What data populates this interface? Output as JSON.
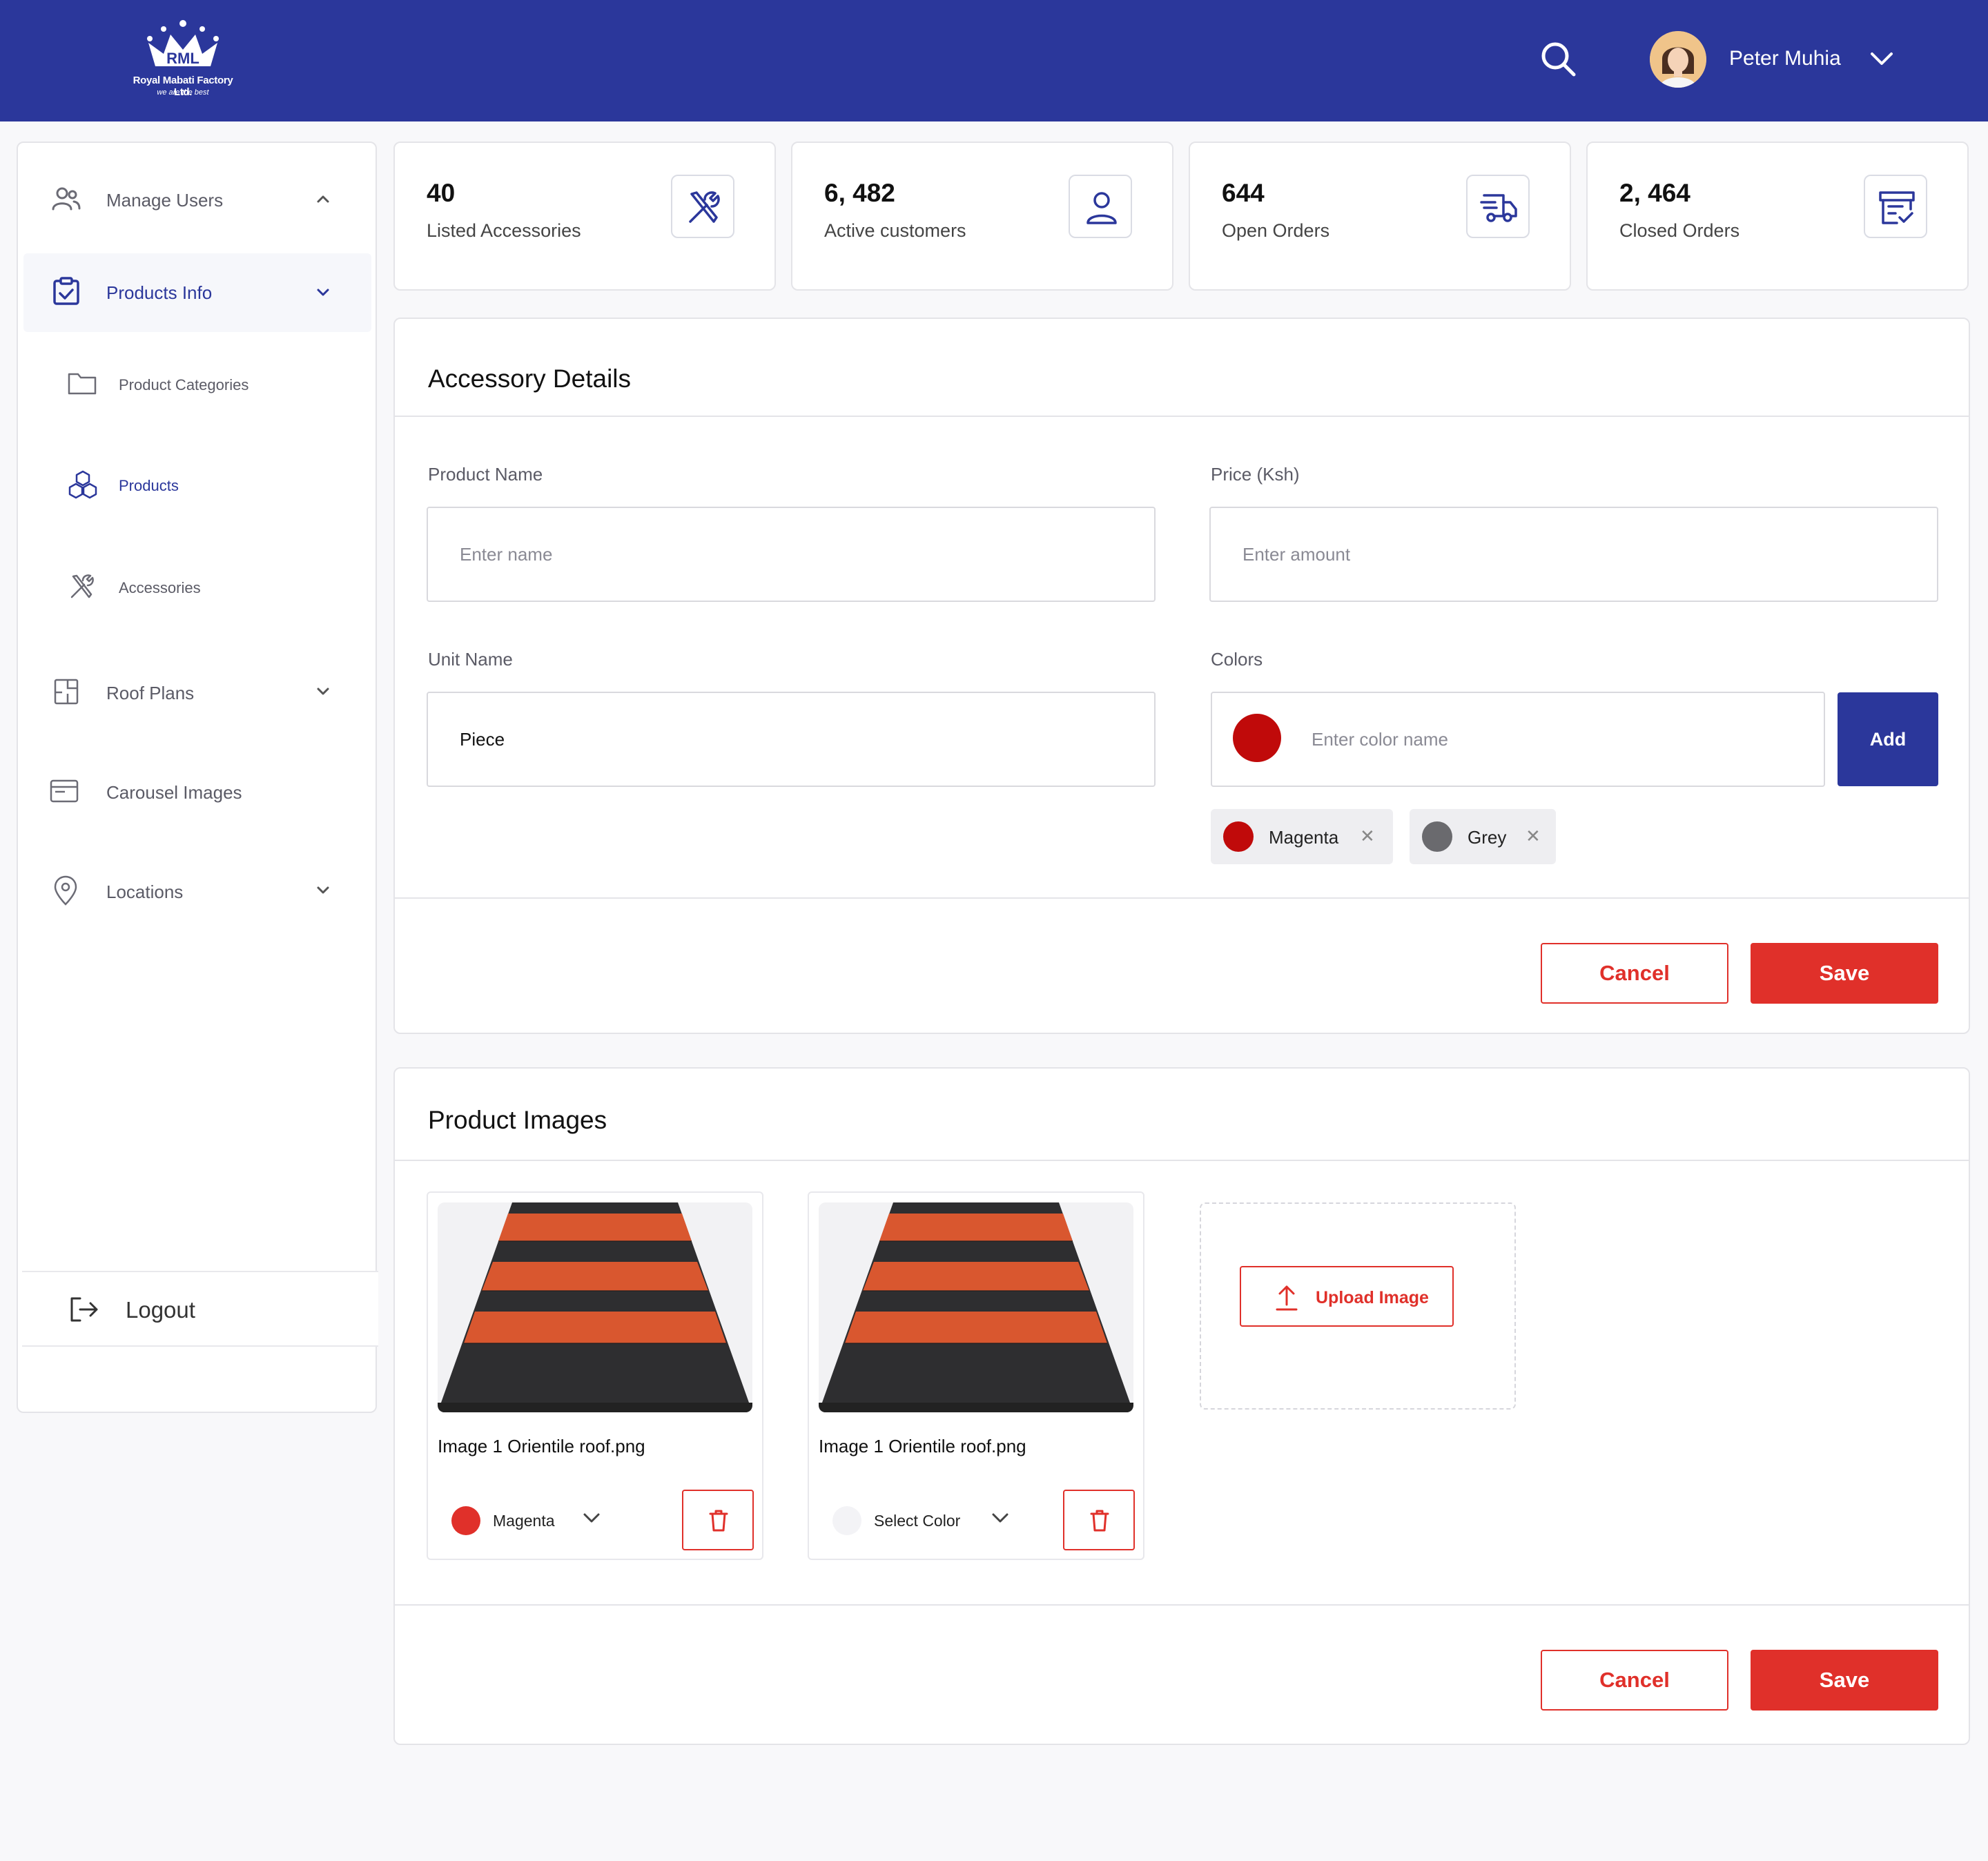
{
  "header": {
    "brand_short": "RML",
    "brand_name": "Royal Mabati Factory Ltd.",
    "brand_tagline": "we are the best",
    "user_name": "Peter Muhia"
  },
  "sidebar": {
    "manage_users": "Manage Users",
    "products_info": "Products Info",
    "product_categories": "Product Categories",
    "products": "Products",
    "accessories": "Accessories",
    "roof_plans": "Roof Plans",
    "carousel_images": "Carousel Images",
    "locations": "Locations",
    "logout": "Logout"
  },
  "stats": [
    {
      "value": "40",
      "label": "Listed Accessories",
      "icon": "tools-icon"
    },
    {
      "value": "6, 482",
      "label": "Active customers",
      "icon": "user-icon"
    },
    {
      "value": "644",
      "label": "Open Orders",
      "icon": "delivery-truck-icon"
    },
    {
      "value": "2, 464",
      "label": "Closed Orders",
      "icon": "archive-check-icon"
    }
  ],
  "accessory_details": {
    "title": "Accessory Details",
    "product_name_label": "Product Name",
    "product_name_placeholder": "Enter name",
    "price_label": "Price (Ksh)",
    "price_placeholder": "Enter amount",
    "unit_label": "Unit Name",
    "unit_value": "Piece",
    "colors_label": "Colors",
    "color_placeholder": "Enter color name",
    "add_label": "Add",
    "chips": [
      {
        "name": "Magenta",
        "color": "#c00a0a"
      },
      {
        "name": "Grey",
        "color": "#6a6a6e"
      }
    ],
    "cancel_label": "Cancel",
    "save_label": "Save"
  },
  "product_images": {
    "title": "Product Images",
    "cards": [
      {
        "filename": "Image 1 Orientile roof.png",
        "color_label": "Magenta",
        "color": "#e0302a"
      },
      {
        "filename": "Image 1 Orientile roof.png",
        "color_label": "Select Color",
        "color": "#f3f3f6"
      }
    ],
    "upload_label": "Upload Image",
    "cancel_label": "Cancel",
    "save_label": "Save"
  },
  "colors": {
    "primary": "#2b379b",
    "danger": "#e0302a",
    "picker_color": "#c00a0a"
  }
}
